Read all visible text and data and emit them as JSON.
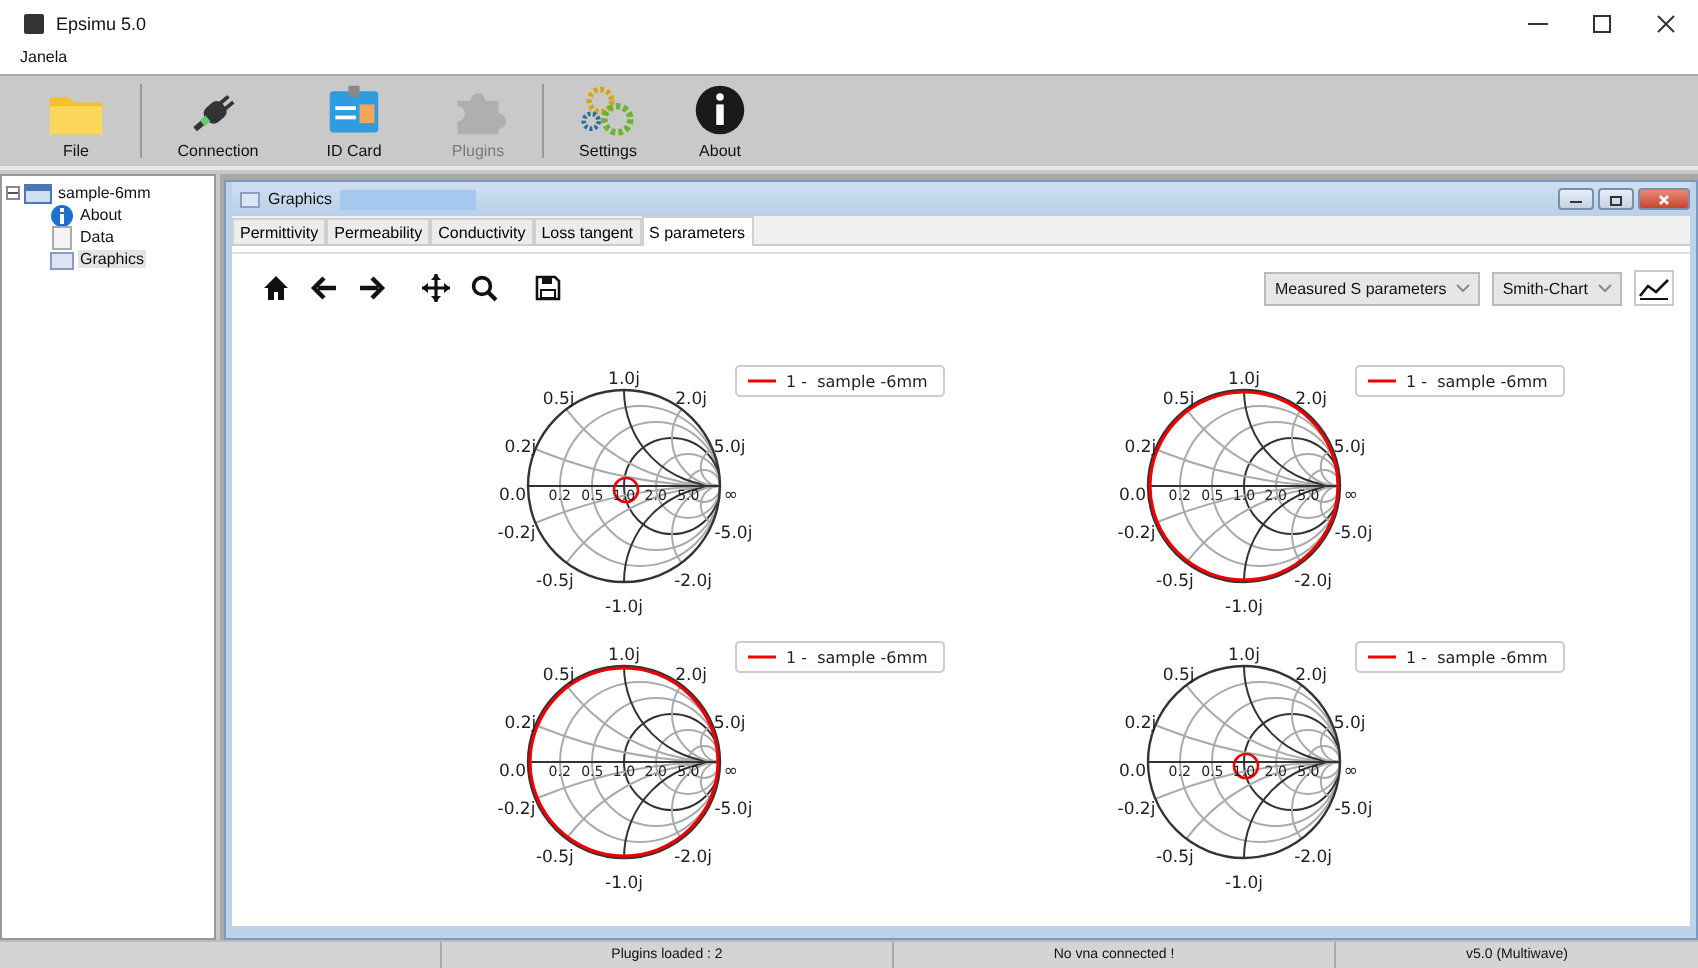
{
  "window": {
    "title": "Epsimu 5.0"
  },
  "menu": [
    "Janela"
  ],
  "toolbar": [
    {
      "label": "File",
      "disabled": false
    },
    {
      "label": "Connection",
      "disabled": false
    },
    {
      "label": "ID Card",
      "disabled": false
    },
    {
      "label": "Plugins",
      "disabled": true
    },
    {
      "label": "Settings",
      "disabled": false
    },
    {
      "label": "About",
      "disabled": false
    }
  ],
  "tree": [
    {
      "label": "sample-6mm",
      "expanded": true,
      "selected": false,
      "children": [
        {
          "label": "About",
          "selected": false
        },
        {
          "label": "Data",
          "selected": false
        },
        {
          "label": "Graphics",
          "selected": true
        }
      ]
    }
  ],
  "graphics_window": {
    "title": "Graphics",
    "tabs": [
      {
        "label": "Permittivity",
        "selected": false
      },
      {
        "label": "Permeability",
        "selected": false
      },
      {
        "label": "Conductivity",
        "selected": false
      },
      {
        "label": "Loss tangent",
        "selected": false
      },
      {
        "label": "S parameters",
        "selected": true
      }
    ],
    "data_select": "Measured S parameters",
    "chart_select": "Smith-Chart",
    "charts": [
      {
        "kind": "center",
        "legend": "1 -  sample -6mm",
        "tick_labels": [
          "1.0j",
          "0.5j",
          "2.0j",
          "0.2j",
          "5.0j",
          "0.0",
          "0.2",
          "0.5",
          "1.0",
          "2.0",
          "5.0",
          "∞",
          "-0.2j",
          "-5.0j",
          "-0.5j",
          "-2.0j",
          "-1.0j"
        ]
      },
      {
        "kind": "rim",
        "legend": "1 -  sample -6mm",
        "tick_labels": [
          "1.0j",
          "0.5j",
          "2.0j",
          "0.2j",
          "5.0j",
          "0.0",
          "0.2",
          "0.5",
          "1.0",
          "2.0",
          "5.0",
          "∞",
          "-0.2j",
          "-5.0j",
          "-0.5j",
          "-2.0j",
          "-1.0j"
        ]
      },
      {
        "kind": "rim",
        "legend": "1 -  sample -6mm",
        "tick_labels": [
          "1.0j",
          "0.5j",
          "2.0j",
          "0.2j",
          "5.0j",
          "0.0",
          "0.2",
          "0.5",
          "1.0",
          "2.0",
          "5.0",
          "∞",
          "-0.2j",
          "-5.0j",
          "-0.5j",
          "-2.0j",
          "-1.0j"
        ]
      },
      {
        "kind": "center",
        "legend": "1 -  sample -6mm",
        "tick_labels": [
          "1.0j",
          "0.5j",
          "2.0j",
          "0.2j",
          "5.0j",
          "0.0",
          "0.2",
          "0.5",
          "1.0",
          "2.0",
          "5.0",
          "∞",
          "-0.2j",
          "-5.0j",
          "-0.5j",
          "-2.0j",
          "-1.0j"
        ]
      }
    ]
  },
  "status_bar": [
    "Plugins loaded : 2",
    "No vna connected !",
    "v5.0 (Multiwave)"
  ]
}
